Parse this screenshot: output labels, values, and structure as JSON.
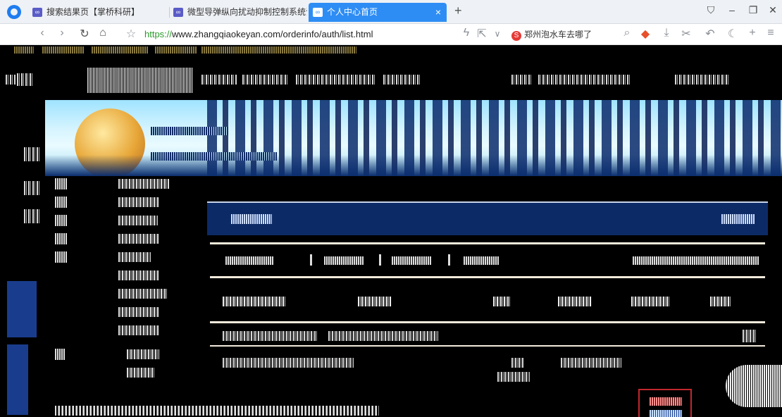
{
  "browser": {
    "tabs": [
      {
        "label": "搜索结果页【掌桥科研】",
        "favicon": "∞",
        "active": false
      },
      {
        "label": "微型导弹纵向扰动抑制控制系统设计-",
        "favicon": "∞",
        "active": false
      },
      {
        "label": "个人中心首页",
        "favicon": "∞",
        "active": true
      }
    ],
    "tab_close_glyph": "×",
    "new_tab_glyph": "+",
    "window_controls": [
      "⛉",
      "–",
      "❐",
      "✕"
    ],
    "url": {
      "protocol": "https://",
      "rest": "www.zhangqiaokeyan.com/orderinfo/auth/list.html"
    },
    "search_suggestion": {
      "badge": "S",
      "text": "郑州泡水车去哪了"
    },
    "toolbar_icons": [
      "back-icon",
      "forward-icon",
      "refresh-icon",
      "home-icon",
      "star-icon",
      "lightning-icon",
      "share-icon",
      "chevron-down-icon",
      "search-icon",
      "game-icon",
      "download-icon",
      "scissors-icon",
      "undo-icon",
      "moon-icon",
      "plus-icon",
      "menu-icon"
    ],
    "toolbar_glyphs": {
      "back": "‹",
      "forward": "›",
      "refresh": "↻",
      "home": "⌂",
      "star": "☆",
      "lightning": "ϟ",
      "share": "⇱",
      "chevron": "∨",
      "search": "⌕",
      "game": "◆",
      "download": "⤓",
      "scissors": "✂",
      "undo": "↶",
      "moon": "☾",
      "plus": "+",
      "menu": "≡"
    }
  },
  "colors": {
    "active_tab": "#2e8df4",
    "url_protocol": "#2a9a2a",
    "banner_dark": "#0c2a66",
    "highlight_box": "#c1272d"
  }
}
